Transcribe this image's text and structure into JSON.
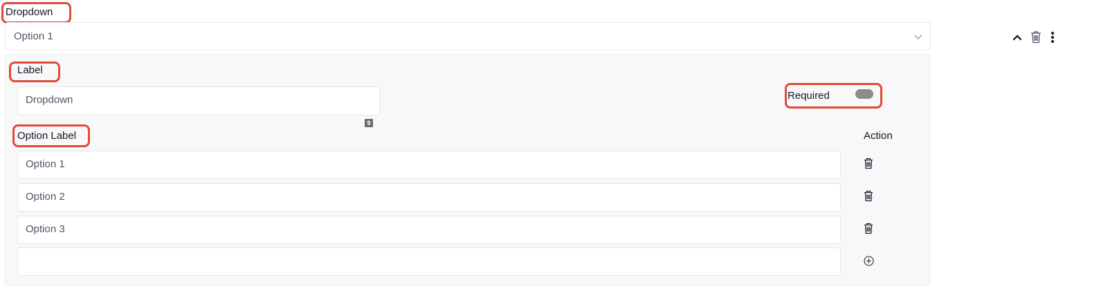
{
  "field": {
    "title": "Dropdown",
    "selected_value": "Option 1"
  },
  "label_section": {
    "title": "Label",
    "value": "Dropdown",
    "counter_badge": "9"
  },
  "required": {
    "label": "Required",
    "enabled": false
  },
  "options": {
    "header_label": "Option Label",
    "header_action": "Action",
    "items": [
      {
        "value": "Option 1"
      },
      {
        "value": "Option 2"
      },
      {
        "value": "Option 3"
      }
    ],
    "new_item_value": ""
  },
  "icons": {
    "select": "chevron-down-icon",
    "collapse": "chevron-up-icon",
    "delete": "trash-icon",
    "more": "more-vertical-icon",
    "add": "plus-circle-icon"
  },
  "colors": {
    "highlight": "#e04a3a",
    "panel_bg": "#f8f8f8",
    "toggle_off": "#8b8b8b"
  }
}
